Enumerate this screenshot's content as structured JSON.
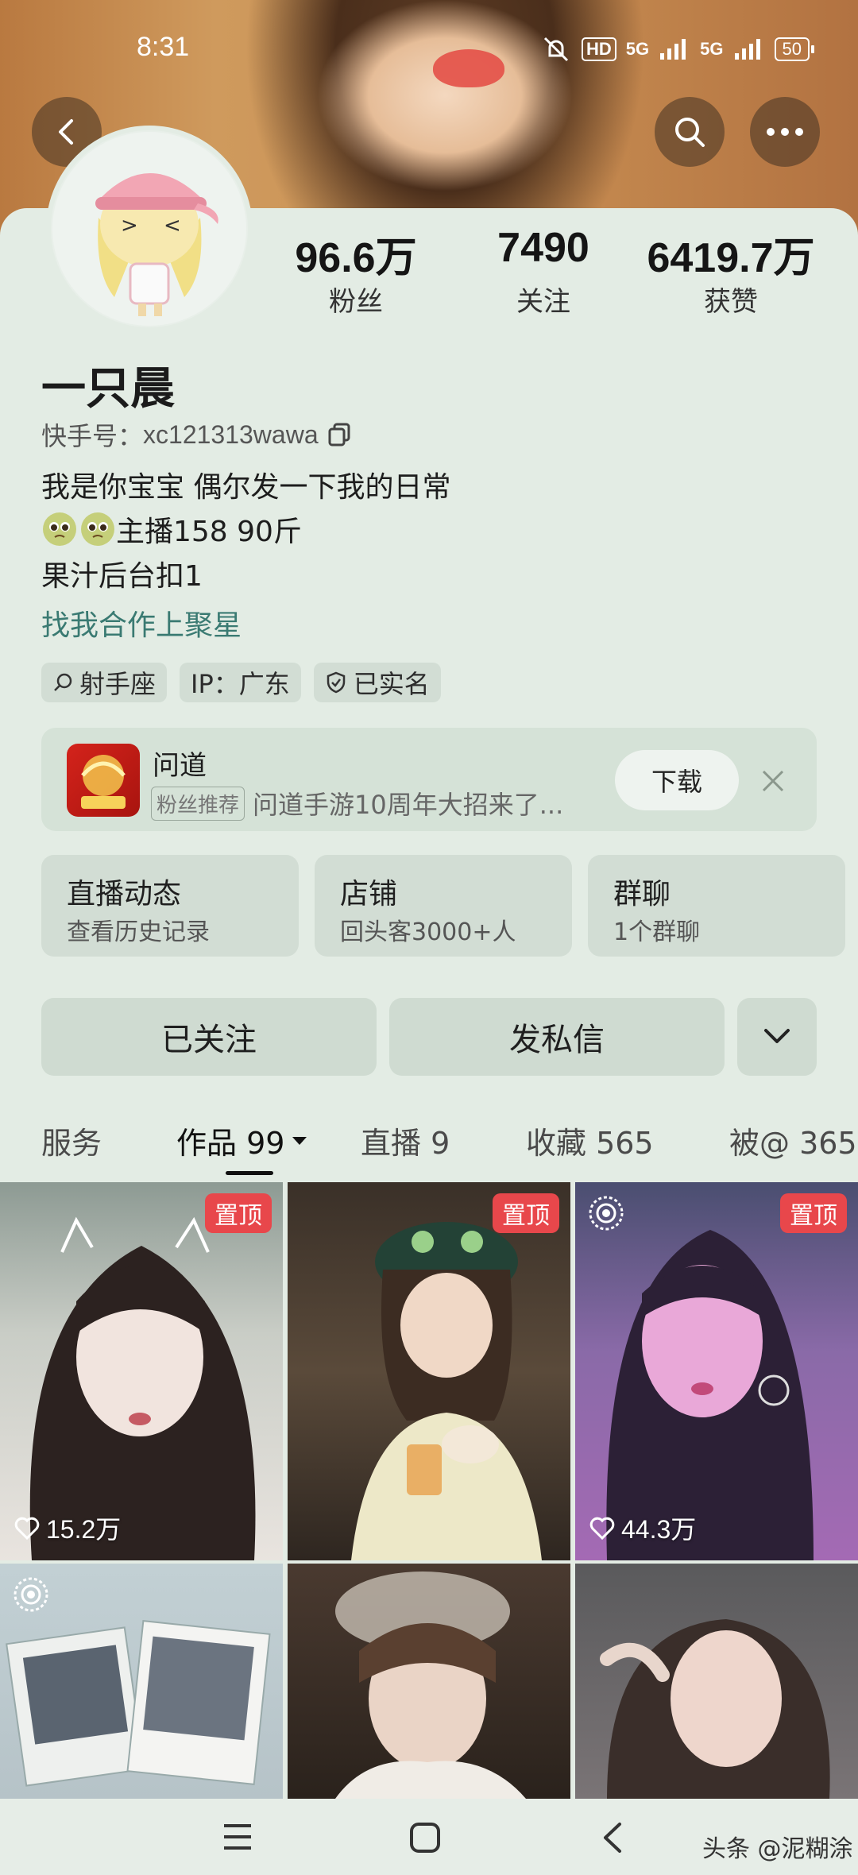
{
  "status": {
    "time": "8:31",
    "hd": "HD",
    "net1": "5G",
    "net2": "5G",
    "battery": "50"
  },
  "profile": {
    "followers_num": "96.6万",
    "followers_label": "粉丝",
    "following_num": "7490",
    "following_label": "关注",
    "likes_num": "6419.7万",
    "likes_label": "获赞",
    "name": "一只晨",
    "id_prefix": "快手号：",
    "id": "xc121313wawa",
    "bio1": "我是你宝宝  偶尔发一下我的日常",
    "bio2": "主播158 90斤",
    "bio3": "果汁后台扣1",
    "link": "找我合作上聚星",
    "tags": [
      "射手座",
      "IP：广东",
      "已实名"
    ]
  },
  "ad": {
    "title": "问道",
    "badge": "粉丝推荐",
    "desc": "问道手游10周年大招来了...",
    "button": "下载"
  },
  "cards": [
    {
      "title": "直播动态",
      "sub": "查看历史记录"
    },
    {
      "title": "店铺",
      "sub": "回头客3000+人"
    },
    {
      "title": "群聊",
      "sub": "1个群聊"
    }
  ],
  "actions": {
    "followed": "已关注",
    "message": "发私信"
  },
  "tabs": [
    {
      "label": "服务"
    },
    {
      "label": "作品 99"
    },
    {
      "label": "直播 9"
    },
    {
      "label": "收藏 565"
    },
    {
      "label": "被@ 365"
    }
  ],
  "posts": [
    {
      "pin": "置顶",
      "likes": "15.2万"
    },
    {
      "pin": "置顶",
      "likes": ""
    },
    {
      "pin": "置顶",
      "likes": "44.3万"
    }
  ],
  "watermark": "头条 @泥糊涂"
}
